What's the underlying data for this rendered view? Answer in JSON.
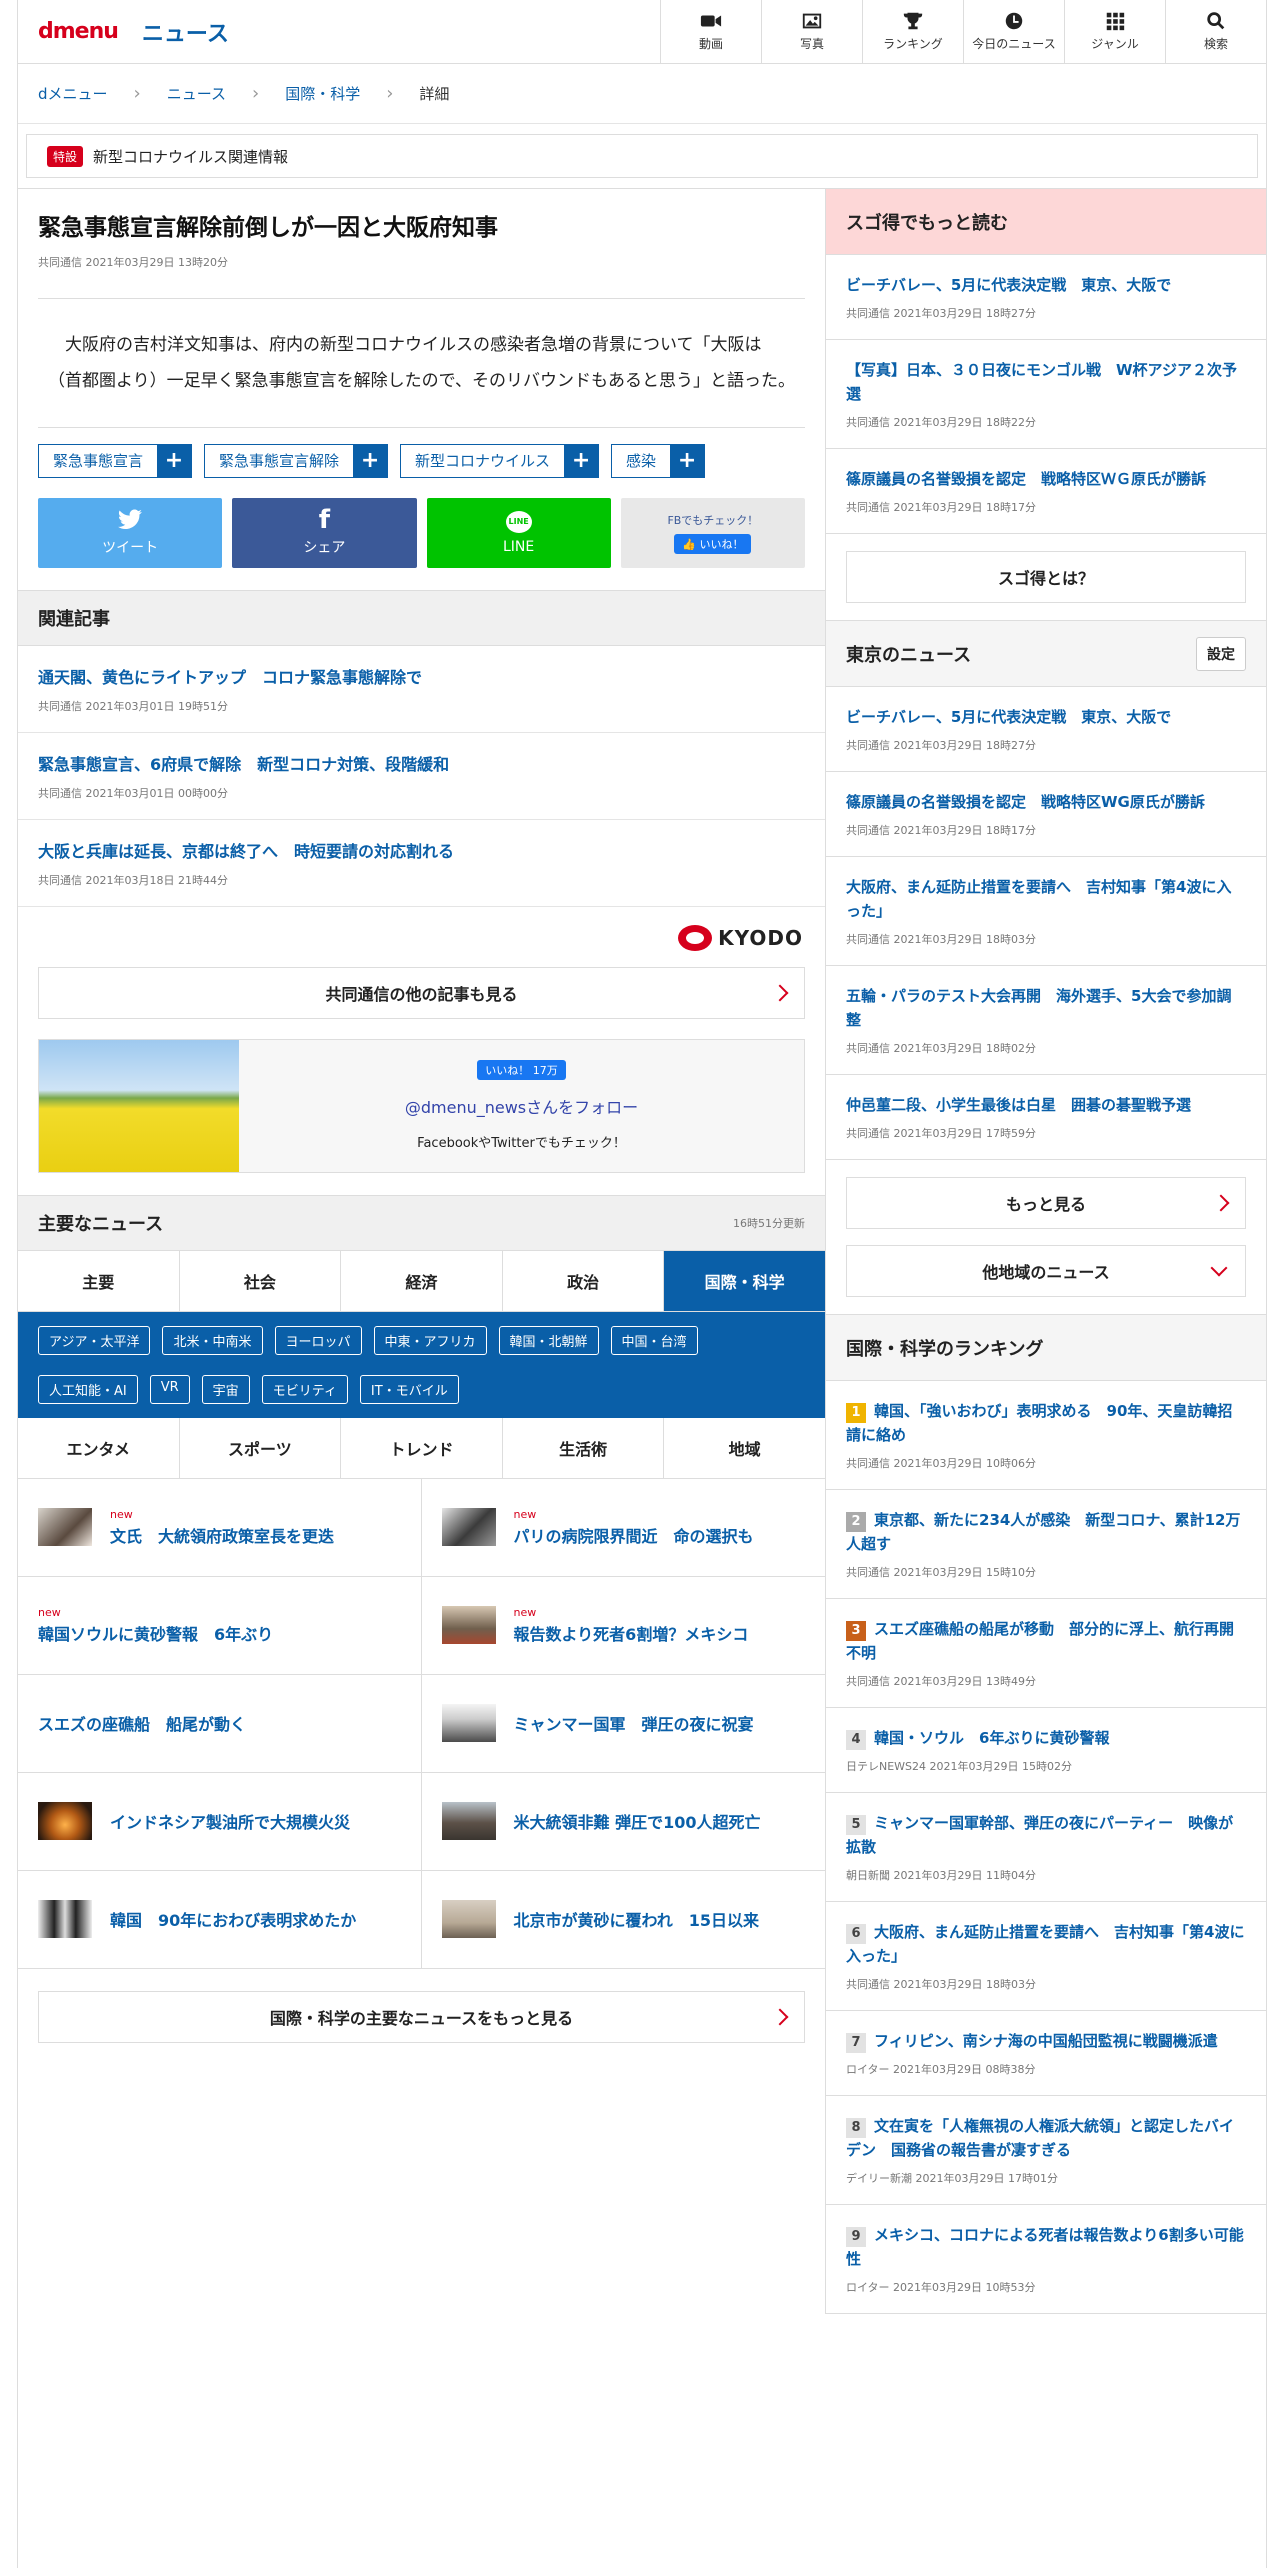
{
  "header": {
    "logo_d": "dmenu",
    "logo_news": "ニュース",
    "nav": [
      "動画",
      "写真",
      "ランキング",
      "今日のニュース",
      "ジャンル",
      "検索"
    ]
  },
  "breadcrumb": [
    "dメニュー",
    "ニュース",
    "国際・科学",
    "詳細"
  ],
  "special": {
    "tag": "特設",
    "label": "新型コロナウイルス関連情報"
  },
  "article": {
    "title": "緊急事態宣言解除前倒しが一因と大阪府知事",
    "meta": "共同通信 2021年03月29日 13時20分",
    "body": "大阪府の吉村洋文知事は、府内の新型コロナウイルスの感染者急増の背景について「大阪は（首都圏より）一足早く緊急事態宣言を解除したので、そのリバウンドもあると思う」と語った。",
    "tags": [
      "緊急事態宣言",
      "緊急事態宣言解除",
      "新型コロナウイルス",
      "感染"
    ]
  },
  "share": {
    "tweet": "ツイート",
    "share": "シェア",
    "line": "LINE",
    "fb_check": "FBでもチェック！",
    "fb_like": "いいね！"
  },
  "related": {
    "title": "関連記事",
    "items": [
      {
        "title": "通天閣、黄色にライトアップ　コロナ緊急事態解除で",
        "meta": "共同通信 2021年03月01日 19時51分"
      },
      {
        "title": "緊急事態宣言、6府県で解除　新型コロナ対策、段階緩和",
        "meta": "共同通信 2021年03月01日 00時00分"
      },
      {
        "title": "大阪と兵庫は延長、京都は終了へ　時短要請の対応割れる",
        "meta": "共同通信 2021年03月18日 21時44分"
      }
    ]
  },
  "kyodo": "KYODO",
  "kyodo_more": "共同通信の他の記事も見る",
  "follow": {
    "like": "いいね！ 17万",
    "handle": "@dmenu_newsさんをフォロー",
    "sub": "FacebookやTwitterでもチェック！"
  },
  "main_news": {
    "title": "主要なニュース",
    "updated": "16時51分更新",
    "tabs1": [
      "主要",
      "社会",
      "経済",
      "政治",
      "国際・科学"
    ],
    "subcats": [
      "アジア・太平洋",
      "北米・中南米",
      "ヨーロッパ",
      "中東・アフリカ",
      "韓国・北朝鮮",
      "中国・台湾",
      "人工知能・AI",
      "VR",
      "宇宙",
      "モビリティ",
      "IT・モバイル"
    ],
    "tabs2": [
      "エンタメ",
      "スポーツ",
      "トレンド",
      "生活術",
      "地域"
    ],
    "items": [
      {
        "new": "new",
        "title": "文氏　大統領府政策室長を更迭"
      },
      {
        "new": "new",
        "title": "パリの病院限界間近　命の選択も"
      },
      {
        "new": "new",
        "title": "韓国ソウルに黄砂警報　6年ぶり"
      },
      {
        "new": "new",
        "title": "報告数より死者6割増？メキシコ"
      },
      {
        "new": "",
        "title": "スエズの座礁船　船尾が動く"
      },
      {
        "new": "",
        "title": "ミャンマー国軍　弾圧の夜に祝宴"
      },
      {
        "new": "",
        "title": "インドネシア製油所で大規模火災"
      },
      {
        "new": "",
        "title": "米大統領非難 弾圧で100人超死亡"
      },
      {
        "new": "",
        "title": "韓国　90年におわび表明求めたか"
      },
      {
        "new": "",
        "title": "北京市が黄砂に覆われ　15日以来"
      }
    ],
    "more": "国際・科学の主要なニュースをもっと見る"
  },
  "side": {
    "sugotoku": {
      "title": "スゴ得でもっと読む",
      "items": [
        {
          "title": "ビーチバレー、5月に代表決定戦　東京、大阪で",
          "meta": "共同通信 2021年03月29日 18時27分"
        },
        {
          "title": "【写真】日本、３０日夜にモンゴル戦　W杯アジア２次予選",
          "meta": "共同通信 2021年03月29日 18時22分"
        },
        {
          "title": "篠原議員の名誉毀損を認定　戦略特区ＷＧ原氏が勝訴",
          "meta": "共同通信 2021年03月29日 18時17分"
        }
      ],
      "btn": "スゴ得とは？"
    },
    "tokyo": {
      "title": "東京のニュース",
      "setting": "設定",
      "items": [
        {
          "title": "ビーチバレー、5月に代表決定戦　東京、大阪で",
          "meta": "共同通信 2021年03月29日 18時27分"
        },
        {
          "title": "篠原議員の名誉毀損を認定　戦略特区WG原氏が勝訴",
          "meta": "共同通信 2021年03月29日 18時17分"
        },
        {
          "title": "大阪府、まん延防止措置を要請へ　吉村知事「第4波に入った」",
          "meta": "共同通信 2021年03月29日 18時03分"
        },
        {
          "title": "五輪・パラのテスト大会再開　海外選手、5大会で参加調整",
          "meta": "共同通信 2021年03月29日 18時02分"
        },
        {
          "title": "仲邑菫二段、小学生最後は白星　囲碁の碁聖戦予選",
          "meta": "共同通信 2021年03月29日 17時59分"
        }
      ],
      "more": "もっと見る",
      "other": "他地域のニュース"
    },
    "ranking": {
      "title": "国際・科学のランキング",
      "items": [
        {
          "n": "1",
          "title": "韓国、「強いおわび」表明求める　90年、天皇訪韓招請に絡め",
          "meta": "共同通信 2021年03月29日 10時06分"
        },
        {
          "n": "2",
          "title": "東京都、新たに234人が感染　新型コロナ、累計12万人超す",
          "meta": "共同通信 2021年03月29日 15時10分"
        },
        {
          "n": "3",
          "title": "スエズ座礁船の船尾が移動　部分的に浮上、航行再開不明",
          "meta": "共同通信 2021年03月29日 13時49分"
        },
        {
          "n": "4",
          "title": "韓国・ソウル　6年ぶりに黄砂警報",
          "meta": "日テレNEWS24 2021年03月29日 15時02分"
        },
        {
          "n": "5",
          "title": "ミャンマー国軍幹部、弾圧の夜にパーティー　映像が拡散",
          "meta": "朝日新聞 2021年03月29日 11時04分"
        },
        {
          "n": "6",
          "title": "大阪府、まん延防止措置を要請へ　吉村知事「第4波に入った」",
          "meta": "共同通信 2021年03月29日 18時03分"
        },
        {
          "n": "7",
          "title": "フィリピン、南シナ海の中国船団監視に戦闘機派遣",
          "meta": "ロイター 2021年03月29日 08時38分"
        },
        {
          "n": "8",
          "title": "文在寅を「人権無視の人権派大統領」と認定したバイデン　国務省の報告書が凄すぎる",
          "meta": "デイリー新潮 2021年03月29日 17時01分"
        },
        {
          "n": "9",
          "title": "メキシコ、コロナによる死者は報告数より6割多い可能性",
          "meta": "ロイター 2021年03月29日 10時53分"
        }
      ]
    }
  },
  "colors": {
    "brand_red": "#d6001c",
    "link_blue": "#0a5fa8",
    "twitter": "#55acee",
    "facebook": "#3b5998",
    "line": "#00c300",
    "sugotoku_bg": "#fdd7d7",
    "rank1": "#f0b400",
    "rank3": "#c8601a"
  }
}
